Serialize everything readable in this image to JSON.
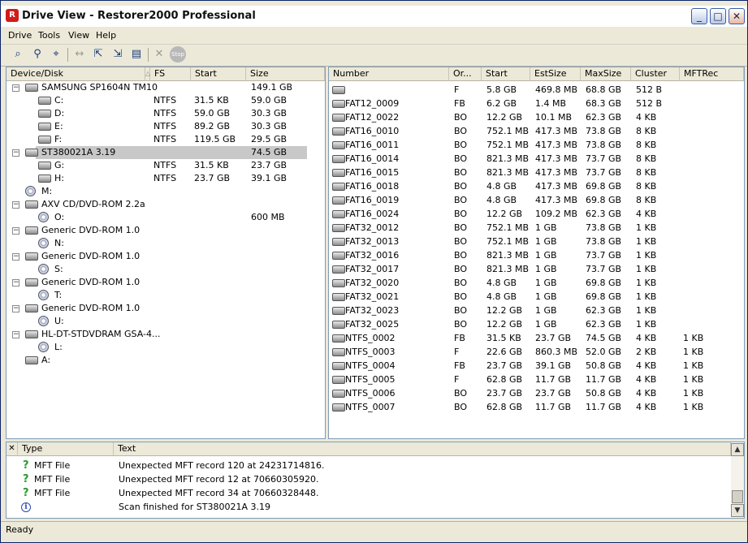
{
  "window": {
    "title": "Drive View - Restorer2000 Professional",
    "app_icon_letter": "R"
  },
  "menu": [
    "Drive",
    "Tools",
    "View",
    "Help"
  ],
  "toolbar_icons": [
    "scan-icon",
    "search-icon",
    "find-icon",
    "swap-icon",
    "export-icon",
    "import-icon",
    "save-icon",
    "delete-icon",
    "stop-icon"
  ],
  "toolbar_stop_label": "Stop",
  "tree": {
    "headers": [
      "Device/Disk",
      "FS",
      "Start",
      "Size"
    ],
    "rows": [
      {
        "level": 0,
        "type": "disk",
        "expander": "−",
        "name": "SAMSUNG SP1604N TM10",
        "fs": "",
        "start": "",
        "size": "149.1 GB",
        "selected": false
      },
      {
        "level": 1,
        "type": "part",
        "name": "C:",
        "fs": "NTFS",
        "start": "31.5 KB",
        "size": "59.0 GB",
        "selected": false
      },
      {
        "level": 1,
        "type": "part",
        "name": "D:",
        "fs": "NTFS",
        "start": "59.0 GB",
        "size": "30.3 GB",
        "selected": false
      },
      {
        "level": 1,
        "type": "part",
        "name": "E:",
        "fs": "NTFS",
        "start": "89.2 GB",
        "size": "30.3 GB",
        "selected": false
      },
      {
        "level": 1,
        "type": "part",
        "name": "F:",
        "fs": "NTFS",
        "start": "119.5 GB",
        "size": "29.5 GB",
        "selected": false
      },
      {
        "level": 0,
        "type": "disk",
        "expander": "−",
        "name": "ST380021A 3.19",
        "fs": "",
        "start": "",
        "size": "74.5 GB",
        "selected": true
      },
      {
        "level": 1,
        "type": "part",
        "name": "G:",
        "fs": "NTFS",
        "start": "31.5 KB",
        "size": "23.7 GB",
        "selected": false
      },
      {
        "level": 1,
        "type": "part",
        "name": "H:",
        "fs": "NTFS",
        "start": "23.7 GB",
        "size": "39.1 GB",
        "selected": false
      },
      {
        "level": 0,
        "type": "cd",
        "expander": "",
        "name": "M:",
        "fs": "",
        "start": "",
        "size": "",
        "selected": false
      },
      {
        "level": 0,
        "type": "disk",
        "expander": "−",
        "name": "AXV CD/DVD-ROM 2.2a",
        "fs": "",
        "start": "",
        "size": "",
        "selected": false
      },
      {
        "level": 1,
        "type": "cd",
        "name": "O:",
        "fs": "",
        "start": "",
        "size": "600 MB",
        "selected": false
      },
      {
        "level": 0,
        "type": "disk",
        "expander": "−",
        "name": "Generic DVD-ROM 1.0",
        "fs": "",
        "start": "",
        "size": "",
        "selected": false
      },
      {
        "level": 1,
        "type": "cd",
        "name": "N:",
        "fs": "",
        "start": "",
        "size": "",
        "selected": false
      },
      {
        "level": 0,
        "type": "disk",
        "expander": "−",
        "name": "Generic DVD-ROM 1.0",
        "fs": "",
        "start": "",
        "size": "",
        "selected": false
      },
      {
        "level": 1,
        "type": "cd",
        "name": "S:",
        "fs": "",
        "start": "",
        "size": "",
        "selected": false
      },
      {
        "level": 0,
        "type": "disk",
        "expander": "−",
        "name": "Generic DVD-ROM 1.0",
        "fs": "",
        "start": "",
        "size": "",
        "selected": false
      },
      {
        "level": 1,
        "type": "cd",
        "name": "T:",
        "fs": "",
        "start": "",
        "size": "",
        "selected": false
      },
      {
        "level": 0,
        "type": "disk",
        "expander": "−",
        "name": "Generic DVD-ROM 1.0",
        "fs": "",
        "start": "",
        "size": "",
        "selected": false
      },
      {
        "level": 1,
        "type": "cd",
        "name": "U:",
        "fs": "",
        "start": "",
        "size": "",
        "selected": false
      },
      {
        "level": 0,
        "type": "disk",
        "expander": "−",
        "name": "HL-DT-STDVDRAM GSA-4...",
        "fs": "",
        "start": "",
        "size": "",
        "selected": false
      },
      {
        "level": 1,
        "type": "cd",
        "name": "L:",
        "fs": "",
        "start": "",
        "size": "",
        "selected": false
      },
      {
        "level": 0,
        "type": "floppy",
        "expander": "",
        "name": "A:",
        "fs": "",
        "start": "",
        "size": "",
        "selected": false
      }
    ]
  },
  "partitions": {
    "headers": [
      "Number",
      "Or...",
      "Start",
      "EstSize",
      "MaxSize",
      "Cluster",
      "MFTRec"
    ],
    "rows": [
      [
        "",
        "F",
        "5.8 GB",
        "469.8 MB",
        "68.8 GB",
        "512 B",
        ""
      ],
      [
        "FAT12_0009",
        "FB",
        "6.2 GB",
        "1.4 MB",
        "68.3 GB",
        "512 B",
        ""
      ],
      [
        "FAT12_0022",
        "BO",
        "12.2 GB",
        "10.1 MB",
        "62.3 GB",
        "4 KB",
        ""
      ],
      [
        "FAT16_0010",
        "BO",
        "752.1 MB",
        "417.3 MB",
        "73.8 GB",
        "8 KB",
        ""
      ],
      [
        "FAT16_0011",
        "BO",
        "752.1 MB",
        "417.3 MB",
        "73.8 GB",
        "8 KB",
        ""
      ],
      [
        "FAT16_0014",
        "BO",
        "821.3 MB",
        "417.3 MB",
        "73.7 GB",
        "8 KB",
        ""
      ],
      [
        "FAT16_0015",
        "BO",
        "821.3 MB",
        "417.3 MB",
        "73.7 GB",
        "8 KB",
        ""
      ],
      [
        "FAT16_0018",
        "BO",
        "4.8 GB",
        "417.3 MB",
        "69.8 GB",
        "8 KB",
        ""
      ],
      [
        "FAT16_0019",
        "BO",
        "4.8 GB",
        "417.3 MB",
        "69.8 GB",
        "8 KB",
        ""
      ],
      [
        "FAT16_0024",
        "BO",
        "12.2 GB",
        "109.2 MB",
        "62.3 GB",
        "4 KB",
        ""
      ],
      [
        "FAT32_0012",
        "BO",
        "752.1 MB",
        "1 GB",
        "73.8 GB",
        "1 KB",
        ""
      ],
      [
        "FAT32_0013",
        "BO",
        "752.1 MB",
        "1 GB",
        "73.8 GB",
        "1 KB",
        ""
      ],
      [
        "FAT32_0016",
        "BO",
        "821.3 MB",
        "1 GB",
        "73.7 GB",
        "1 KB",
        ""
      ],
      [
        "FAT32_0017",
        "BO",
        "821.3 MB",
        "1 GB",
        "73.7 GB",
        "1 KB",
        ""
      ],
      [
        "FAT32_0020",
        "BO",
        "4.8 GB",
        "1 GB",
        "69.8 GB",
        "1 KB",
        ""
      ],
      [
        "FAT32_0021",
        "BO",
        "4.8 GB",
        "1 GB",
        "69.8 GB",
        "1 KB",
        ""
      ],
      [
        "FAT32_0023",
        "BO",
        "12.2 GB",
        "1 GB",
        "62.3 GB",
        "1 KB",
        ""
      ],
      [
        "FAT32_0025",
        "BO",
        "12.2 GB",
        "1 GB",
        "62.3 GB",
        "1 KB",
        ""
      ],
      [
        "NTFS_0002",
        "FB",
        "31.5 KB",
        "23.7 GB",
        "74.5 GB",
        "4 KB",
        "1 KB"
      ],
      [
        "NTFS_0003",
        "F",
        "22.6 GB",
        "860.3 MB",
        "52.0 GB",
        "2 KB",
        "1 KB"
      ],
      [
        "NTFS_0004",
        "FB",
        "23.7 GB",
        "39.1 GB",
        "50.8 GB",
        "4 KB",
        "1 KB"
      ],
      [
        "NTFS_0005",
        "F",
        "62.8 GB",
        "11.7 GB",
        "11.7 GB",
        "4 KB",
        "1 KB"
      ],
      [
        "NTFS_0006",
        "BO",
        "23.7 GB",
        "23.7 GB",
        "50.8 GB",
        "4 KB",
        "1 KB"
      ],
      [
        "NTFS_0007",
        "BO",
        "62.8 GB",
        "11.7 GB",
        "11.7 GB",
        "4 KB",
        "1 KB"
      ]
    ]
  },
  "log": {
    "headers": [
      "Type",
      "Text"
    ],
    "rows": [
      {
        "icon": "question-icon",
        "type": "MFT File",
        "text": "Unexpected MFT record 120 at 24231714816."
      },
      {
        "icon": "question-icon",
        "type": "MFT File",
        "text": "Unexpected MFT record 12 at 70660305920."
      },
      {
        "icon": "question-icon",
        "type": "MFT File",
        "text": "Unexpected MFT record 34 at 70660328448."
      },
      {
        "icon": "info-icon",
        "type": "",
        "text": "Scan finished for ST380021A 3.19"
      }
    ]
  },
  "status": "Ready",
  "colors": {
    "selection": "#c8c8c8",
    "pane_border": "#7f9db9",
    "chrome": "#ece9d8"
  }
}
